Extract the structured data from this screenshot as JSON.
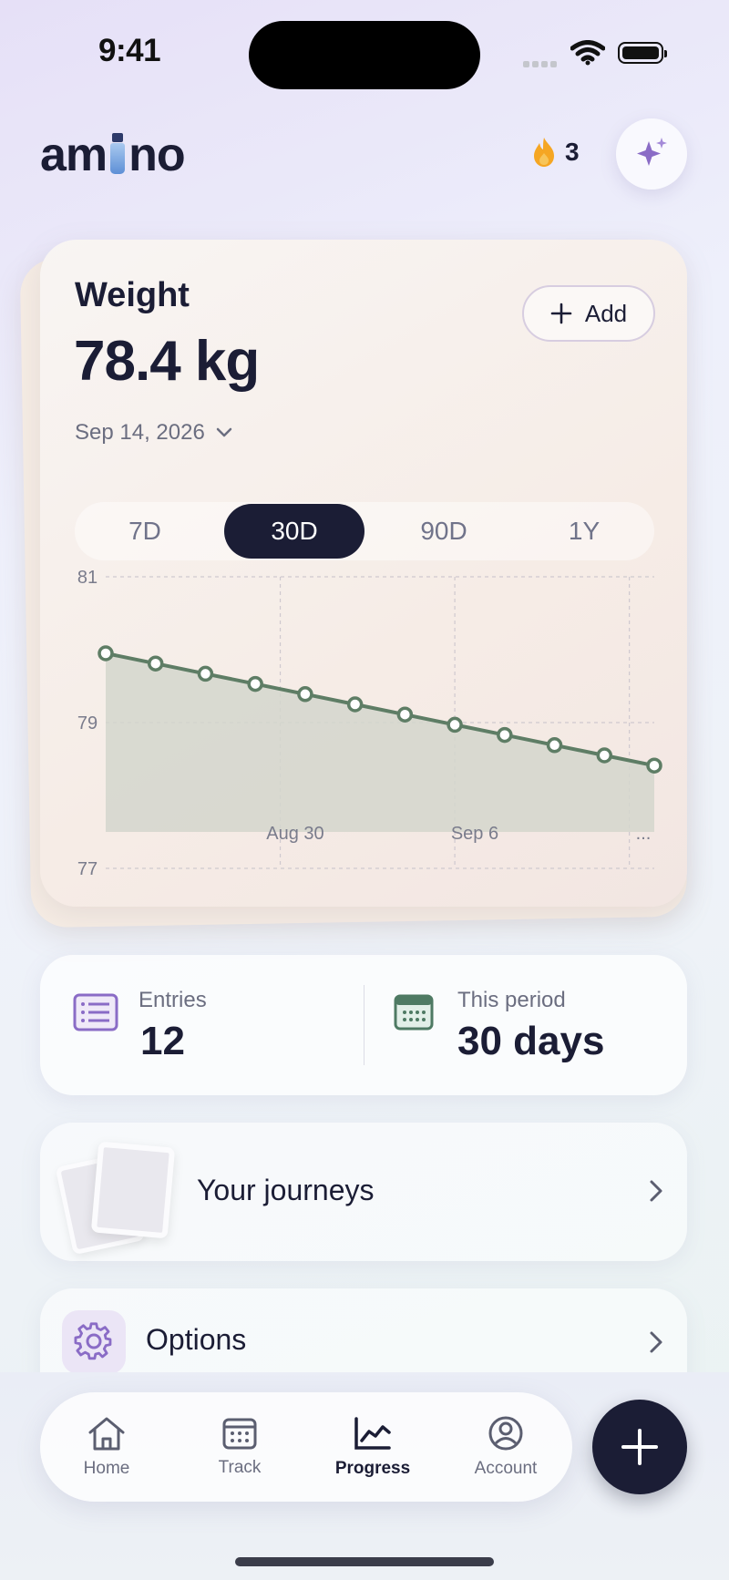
{
  "status_bar": {
    "time": "9:41"
  },
  "header": {
    "logo_text_left": "am",
    "logo_text_right": "no",
    "streak_count": "3",
    "ai_button_icon": "sparkle-icon"
  },
  "weight_card": {
    "title": "Weight",
    "value": "78.4 kg",
    "date": "Sep 14, 2026",
    "add_label": "Add",
    "ranges": [
      "7D",
      "30D",
      "90D",
      "1Y"
    ],
    "active_range": "30D"
  },
  "chart_data": {
    "type": "area",
    "y_ticks": [
      "81",
      "79",
      "77"
    ],
    "ylim": [
      77,
      81
    ],
    "x_tick_labels": [
      "Aug 30",
      "Sep 6",
      "..."
    ],
    "series": [
      {
        "values": [
          79.95,
          79.81,
          79.67,
          79.53,
          79.39,
          79.25,
          79.11,
          78.97,
          78.83,
          78.69,
          78.55,
          78.41
        ]
      }
    ],
    "line_color": "#5e7d65",
    "fill_color": "#d4d6cc",
    "grid": true
  },
  "stats": {
    "entries_label": "Entries",
    "entries_value": "12",
    "period_label": "This period",
    "period_value": "30 days"
  },
  "journeys": {
    "label": "Your journeys"
  },
  "options": {
    "label": "Options"
  },
  "tabbar": {
    "tabs": [
      {
        "label": "Home",
        "icon": "home-icon"
      },
      {
        "label": "Track",
        "icon": "calendar-icon"
      },
      {
        "label": "Progress",
        "icon": "chart-icon"
      },
      {
        "label": "Account",
        "icon": "person-icon"
      }
    ],
    "active": "Progress"
  },
  "colors": {
    "accent": "#1b1d35",
    "purple": "#8a6cc6",
    "green": "#4e7a63",
    "flame": "#f5a623"
  }
}
